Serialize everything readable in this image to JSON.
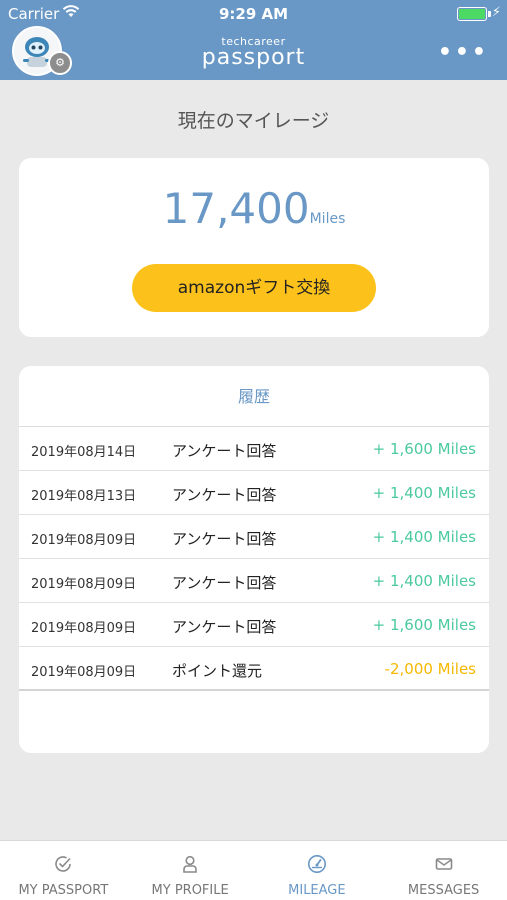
{
  "status_bar": {
    "carrier": "Carrier",
    "time": "9:29 AM"
  },
  "header": {
    "brand_small": "techcareer",
    "brand_big": "passport",
    "more_icon": "more-dots-icon",
    "bg_color": "#6a98c6"
  },
  "mileage": {
    "title": "現在のマイレージ",
    "value": "17,400",
    "unit": "Miles",
    "gift_button": "amazonギフト交換",
    "button_color": "#fcc21b"
  },
  "history": {
    "title": "履歴",
    "rows": [
      {
        "date": "2019年08月14日",
        "description": "アンケート回答",
        "amount": "+ 1,600 Miles",
        "type": "plus"
      },
      {
        "date": "2019年08月13日",
        "description": "アンケート回答",
        "amount": "+ 1,400 Miles",
        "type": "plus"
      },
      {
        "date": "2019年08月09日",
        "description": "アンケート回答",
        "amount": "+ 1,400 Miles",
        "type": "plus"
      },
      {
        "date": "2019年08月09日",
        "description": "アンケート回答",
        "amount": "+ 1,400 Miles",
        "type": "plus"
      },
      {
        "date": "2019年08月09日",
        "description": "アンケート回答",
        "amount": "+ 1,600 Miles",
        "type": "plus"
      },
      {
        "date": "2019年08月09日",
        "description": "ポイント還元",
        "amount": "-2,000 Miles",
        "type": "minus"
      }
    ],
    "plus_color": "#4bc9a0",
    "minus_color": "#f6b800"
  },
  "tabbar": {
    "tabs": [
      {
        "label": "MY PASSPORT",
        "icon": "passport-check-icon",
        "active": false
      },
      {
        "label": "MY PROFILE",
        "icon": "profile-icon",
        "active": false
      },
      {
        "label": "MILEAGE",
        "icon": "gauge-icon",
        "active": true
      },
      {
        "label": "MESSAGES",
        "icon": "envelope-icon",
        "active": false
      }
    ]
  }
}
